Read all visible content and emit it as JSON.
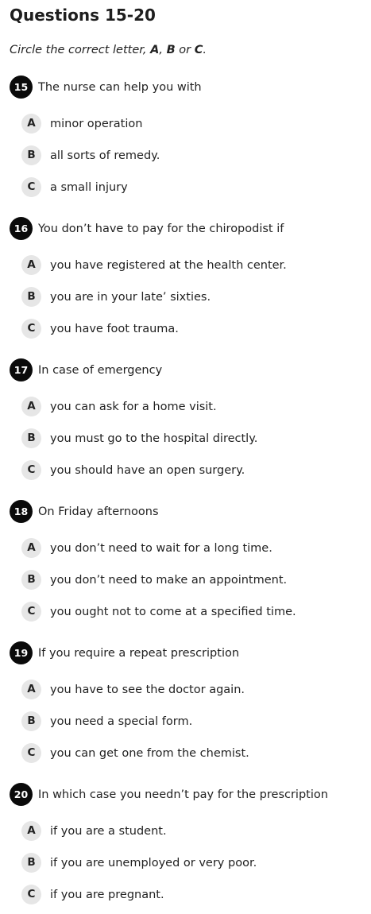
{
  "title": "Questions 15-20",
  "instruction": {
    "prefix": "Circle the correct letter, ",
    "a": "A",
    "sep1": ", ",
    "b": "B",
    "sep2": " or ",
    "c": "C",
    "suffix": "."
  },
  "questions": [
    {
      "number": "15",
      "text": "The nurse can help you with",
      "options": [
        {
          "letter": "A",
          "text": "minor operation"
        },
        {
          "letter": "B",
          "text": "all sorts of remedy."
        },
        {
          "letter": "C",
          "text": "a small injury"
        }
      ]
    },
    {
      "number": "16",
      "text": "You don’t have to pay for the chiropodist if",
      "options": [
        {
          "letter": "A",
          "text": "you have registered at the health center."
        },
        {
          "letter": "B",
          "text": "you are in your late’ sixties."
        },
        {
          "letter": "C",
          "text": "you have foot trauma."
        }
      ]
    },
    {
      "number": "17",
      "text": "In case of emergency",
      "options": [
        {
          "letter": "A",
          "text": "you can ask for a home visit."
        },
        {
          "letter": "B",
          "text": "you must go to the hospital directly."
        },
        {
          "letter": "C",
          "text": "you should have an open surgery."
        }
      ]
    },
    {
      "number": "18",
      "text": "On Friday afternoons",
      "options": [
        {
          "letter": "A",
          "text": "you don’t need to wait for a long time."
        },
        {
          "letter": "B",
          "text": "you don’t need to make an appointment."
        },
        {
          "letter": "C",
          "text": "you ought not to come at a specified time."
        }
      ]
    },
    {
      "number": "19",
      "text": "If you require a repeat prescription",
      "options": [
        {
          "letter": "A",
          "text": "you have to see the doctor again."
        },
        {
          "letter": "B",
          "text": "you need a special form."
        },
        {
          "letter": "C",
          "text": "you can get one from the chemist."
        }
      ]
    },
    {
      "number": "20",
      "text": "In which case you needn’t pay for the prescription",
      "options": [
        {
          "letter": "A",
          "text": "if you are a student."
        },
        {
          "letter": "B",
          "text": "if you are unemployed or very poor."
        },
        {
          "letter": "C",
          "text": "if you are pregnant."
        }
      ]
    }
  ]
}
